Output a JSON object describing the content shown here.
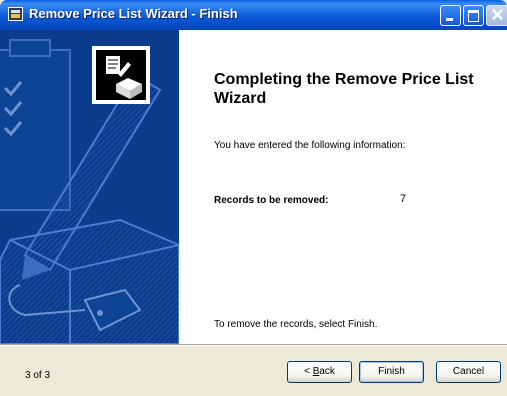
{
  "window": {
    "title": "Remove Price List Wizard - Finish"
  },
  "content": {
    "heading": "Completing the Remove Price List Wizard",
    "intro": "You have entered the following information:",
    "records_label": "Records to be removed:",
    "records_value": "7",
    "footer_note": "To remove the records, select Finish."
  },
  "footer": {
    "step": "3 of 3",
    "back_prefix": "< ",
    "back_accel": "B",
    "back_rest": "ack",
    "finish_label": "Finish",
    "cancel_label": "Cancel"
  }
}
